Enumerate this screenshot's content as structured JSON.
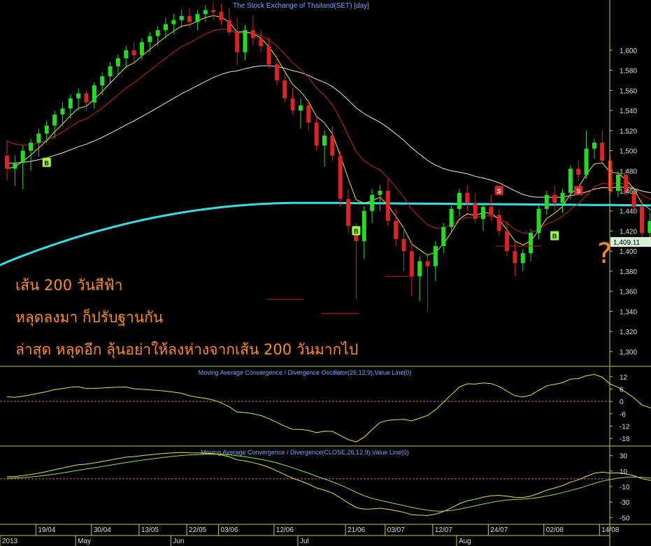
{
  "chart_data": {
    "type": "candlestick",
    "title": "The Stock Exchange of Thailand(SET) [day]",
    "price_axis": {
      "ylim": [
        1286,
        1650
      ],
      "ticks": [
        1300,
        1320,
        1340,
        1360,
        1380,
        1400,
        1420,
        1440,
        1460,
        1480,
        1500,
        1520,
        1540,
        1560,
        1580,
        1600
      ],
      "tick_labels": [
        "1,300",
        "1,320",
        "1,340",
        "1,360",
        "1,380",
        "1,400",
        "1,420",
        "1,440",
        "1,460",
        "1,480",
        "1,500",
        "1,520",
        "1,540",
        "1,560",
        "1,580",
        "1,600"
      ]
    },
    "last_price_label": "1,409.11",
    "last_price": 1409.11,
    "colors": {
      "up": "#22dd22",
      "down": "#dd2222",
      "ma_fast": "#e6e62e",
      "ma_mid": "#cc2222",
      "ma_slow": "#e8e8e8",
      "ma_200": "#33e0e8",
      "support": "#cc2222",
      "panel_border": "#cccc33",
      "axis_text": "#dddddd",
      "title_text": "#6fa8ff",
      "zero_line": "#cc6655",
      "buy_marker": "#99ff33",
      "sell_marker": "#dd2222",
      "annotation": "#ff8c1a"
    },
    "candles": [
      [
        1495,
        1510,
        1470,
        1482
      ],
      [
        1482,
        1495,
        1465,
        1488
      ],
      [
        1488,
        1505,
        1462,
        1500
      ],
      [
        1500,
        1512,
        1480,
        1508
      ],
      [
        1508,
        1522,
        1494,
        1517
      ],
      [
        1517,
        1530,
        1508,
        1525
      ],
      [
        1525,
        1540,
        1512,
        1536
      ],
      [
        1536,
        1548,
        1525,
        1542
      ],
      [
        1542,
        1556,
        1532,
        1552
      ],
      [
        1552,
        1562,
        1540,
        1557
      ],
      [
        1557,
        1560,
        1540,
        1548
      ],
      [
        1548,
        1568,
        1542,
        1565
      ],
      [
        1565,
        1578,
        1555,
        1574
      ],
      [
        1574,
        1588,
        1566,
        1584
      ],
      [
        1584,
        1596,
        1575,
        1592
      ],
      [
        1592,
        1604,
        1582,
        1600
      ],
      [
        1600,
        1608,
        1588,
        1595
      ],
      [
        1595,
        1612,
        1590,
        1608
      ],
      [
        1608,
        1618,
        1598,
        1614
      ],
      [
        1614,
        1624,
        1604,
        1620
      ],
      [
        1620,
        1632,
        1612,
        1626
      ],
      [
        1626,
        1636,
        1616,
        1630
      ],
      [
        1630,
        1640,
        1622,
        1634
      ],
      [
        1634,
        1642,
        1622,
        1628
      ],
      [
        1628,
        1640,
        1620,
        1636
      ],
      [
        1636,
        1645,
        1628,
        1640
      ],
      [
        1640,
        1648,
        1630,
        1638
      ],
      [
        1638,
        1646,
        1625,
        1630
      ],
      [
        1630,
        1642,
        1615,
        1618
      ],
      [
        1618,
        1632,
        1585,
        1598
      ],
      [
        1598,
        1625,
        1590,
        1620
      ],
      [
        1620,
        1635,
        1605,
        1612
      ],
      [
        1612,
        1620,
        1598,
        1604
      ],
      [
        1604,
        1612,
        1582,
        1586
      ],
      [
        1586,
        1595,
        1565,
        1570
      ],
      [
        1570,
        1578,
        1548,
        1552
      ],
      [
        1552,
        1562,
        1536,
        1540
      ],
      [
        1540,
        1552,
        1522,
        1545
      ],
      [
        1545,
        1550,
        1520,
        1528
      ],
      [
        1528,
        1535,
        1500,
        1505
      ],
      [
        1505,
        1520,
        1484,
        1515
      ],
      [
        1515,
        1525,
        1490,
        1495
      ],
      [
        1495,
        1500,
        1445,
        1452
      ],
      [
        1452,
        1462,
        1418,
        1425
      ],
      [
        1425,
        1428,
        1352,
        1410
      ],
      [
        1410,
        1445,
        1392,
        1440
      ],
      [
        1440,
        1462,
        1428,
        1456
      ],
      [
        1456,
        1466,
        1440,
        1460
      ],
      [
        1460,
        1472,
        1425,
        1430
      ],
      [
        1430,
        1442,
        1405,
        1412
      ],
      [
        1412,
        1425,
        1380,
        1400
      ],
      [
        1400,
        1410,
        1355,
        1375
      ],
      [
        1375,
        1395,
        1350,
        1390
      ],
      [
        1390,
        1398,
        1340,
        1385
      ],
      [
        1385,
        1410,
        1370,
        1405
      ],
      [
        1405,
        1428,
        1398,
        1424
      ],
      [
        1424,
        1445,
        1418,
        1442
      ],
      [
        1442,
        1462,
        1435,
        1458
      ],
      [
        1458,
        1466,
        1440,
        1448
      ],
      [
        1448,
        1458,
        1428,
        1432
      ],
      [
        1432,
        1448,
        1420,
        1444
      ],
      [
        1444,
        1456,
        1430,
        1436
      ],
      [
        1436,
        1442,
        1415,
        1420
      ],
      [
        1420,
        1430,
        1395,
        1400
      ],
      [
        1400,
        1410,
        1375,
        1388
      ],
      [
        1388,
        1402,
        1380,
        1398
      ],
      [
        1398,
        1422,
        1390,
        1418
      ],
      [
        1418,
        1446,
        1412,
        1442
      ],
      [
        1442,
        1460,
        1436,
        1456
      ],
      [
        1456,
        1465,
        1440,
        1448
      ],
      [
        1448,
        1462,
        1438,
        1458
      ],
      [
        1458,
        1486,
        1452,
        1482
      ],
      [
        1482,
        1490,
        1470,
        1476
      ],
      [
        1476,
        1520,
        1472,
        1502
      ],
      [
        1502,
        1512,
        1492,
        1508
      ],
      [
        1508,
        1520,
        1488,
        1490
      ],
      [
        1490,
        1496,
        1456,
        1460
      ],
      [
        1460,
        1480,
        1454,
        1476
      ],
      [
        1476,
        1482,
        1455,
        1458
      ],
      [
        1458,
        1462,
        1440,
        1444
      ],
      [
        1444,
        1452,
        1405,
        1418
      ],
      [
        1418,
        1438,
        1408,
        1430
      ],
      [
        1430,
        1436,
        1408,
        1420
      ],
      [
        1420,
        1432,
        1410,
        1428
      ],
      [
        1428,
        1436,
        1412,
        1432
      ],
      [
        1432,
        1445,
        1425,
        1440
      ],
      [
        1440,
        1446,
        1428,
        1434
      ],
      [
        1434,
        1456,
        1430,
        1452
      ],
      [
        1452,
        1462,
        1446,
        1458
      ],
      [
        1458,
        1464,
        1444,
        1450
      ],
      [
        1450,
        1458,
        1440,
        1446
      ],
      [
        1446,
        1452,
        1440,
        1444
      ],
      [
        1444,
        1446,
        1405,
        1409.11
      ]
    ],
    "x_ticks": [
      {
        "index": 4,
        "label": "19/04"
      },
      {
        "index": 11,
        "label": "30/04"
      },
      {
        "index": 17,
        "label": "13/05"
      },
      {
        "index": 23,
        "label": "22/05"
      },
      {
        "index": 27,
        "label": "03/06"
      },
      {
        "index": 34,
        "label": "12/06"
      },
      {
        "index": 43,
        "label": "21/06"
      },
      {
        "index": 48,
        "label": "03/07"
      },
      {
        "index": 54,
        "label": "12/07"
      },
      {
        "index": 61,
        "label": "24/07"
      },
      {
        "index": 68,
        "label": "02/08"
      },
      {
        "index": 75,
        "label": "14/08"
      }
    ],
    "period_labels": [
      {
        "index": 0,
        "label": "2013"
      },
      {
        "index": 9,
        "label": "May"
      },
      {
        "index": 21,
        "label": "Jun"
      },
      {
        "index": 37,
        "label": "Jul"
      },
      {
        "index": 57,
        "label": "Aug"
      }
    ],
    "support_lines": [
      {
        "level": 1352,
        "from": 33,
        "to": 37
      },
      {
        "level": 1338,
        "from": 40,
        "to": 44
      },
      {
        "level": 1375,
        "from": 48,
        "to": 51
      },
      {
        "level": 1405,
        "from": 62,
        "to": 67
      }
    ],
    "signals": [
      {
        "type": "B",
        "index": 5,
        "price": 1488
      },
      {
        "type": "B",
        "index": 44,
        "price": 1420
      },
      {
        "type": "S",
        "index": 62,
        "price": 1460
      },
      {
        "type": "B",
        "index": 69,
        "price": 1415
      },
      {
        "type": "S",
        "index": 72,
        "price": 1460
      }
    ],
    "oscillator": {
      "title": "Moving Average Convergence / Divergence Oscillator(26,12,9),Value Line(0)",
      "ylim": [
        -21,
        15
      ],
      "ticks": [
        12,
        6,
        0,
        -6,
        -12,
        -18
      ],
      "tick_labels": [
        "12",
        "6",
        "0",
        "-6",
        "-12",
        "-18"
      ]
    },
    "macd": {
      "title": "Moving Average Convergence / Divergence(CLOSE,26,12,9),Value Line(0)",
      "ylim": [
        -57,
        37
      ],
      "ticks": [
        30,
        10,
        -10,
        -30,
        -50
      ],
      "tick_labels": [
        "30",
        "10",
        "-10",
        "-30",
        "-50"
      ]
    },
    "annotation_lines": [
      "เส้น 200 วันสีฟ้า",
      "หลุดลงมา ก็ปรับฐานกัน",
      "ล่าสุด หลุดอีก ลุ้นอย่าให้ลงห่างจากเส้น 200 วันมากไป"
    ],
    "question_mark": "?"
  }
}
